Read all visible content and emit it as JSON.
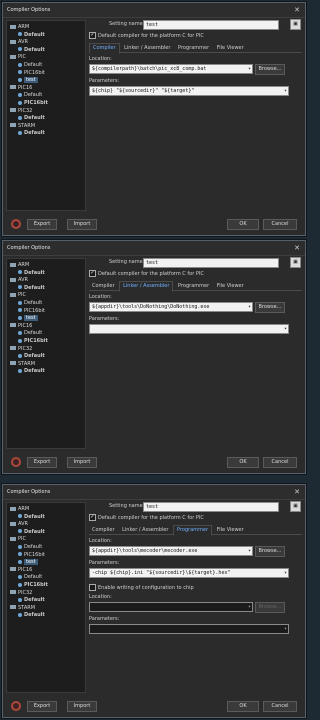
{
  "window_title": "Compiler Options",
  "tree": [
    {
      "label": "ARM",
      "type": "folder"
    },
    {
      "label": "Default",
      "type": "config",
      "bold": true
    },
    {
      "label": "AVR",
      "type": "folder"
    },
    {
      "label": "Default",
      "type": "config",
      "bold": true
    },
    {
      "label": "PIC",
      "type": "folder"
    },
    {
      "label": "Default",
      "type": "config"
    },
    {
      "label": "PIC16bit",
      "type": "config"
    },
    {
      "label": "test",
      "type": "config",
      "selected": true
    },
    {
      "label": "PIC16",
      "type": "folder"
    },
    {
      "label": "Default",
      "type": "config"
    },
    {
      "label": "PIC16bit",
      "type": "config",
      "bold": true
    },
    {
      "label": "PIC32",
      "type": "folder"
    },
    {
      "label": "Default",
      "type": "config",
      "bold": true
    },
    {
      "label": "STARM",
      "type": "folder"
    },
    {
      "label": "Default",
      "type": "config",
      "bold": true
    }
  ],
  "setting_name_label": "Setting name:",
  "setting_name_value": "test",
  "default_checkbox_label": "Default compiler for the platform C for PIC",
  "tabs": [
    "Compiler",
    "Linker / Assembler",
    "Programmer",
    "File Viewer"
  ],
  "location_label": "Location:",
  "parameters_label": "Parameters:",
  "browse_label": "Browse...",
  "export_label": "Export",
  "import_label": "Import",
  "ok_label": "OK",
  "cancel_label": "Cancel",
  "save_icon": "save-icon",
  "dialogs": [
    {
      "active_tab": 0,
      "location": "${compilerpath}\\batch\\pic_xc8_comp.bat",
      "parameters": "${chip} \"${sourcedir}\" \"${target}\""
    },
    {
      "active_tab": 1,
      "location": "${appdir}\\tools\\DoNothing\\DoNothing.exe",
      "parameters": ""
    },
    {
      "active_tab": 2,
      "location": "${appdir}\\tools\\mecoder\\mecoder.exe",
      "parameters": "-chip ${chip}.ini \"${sourcedir}\\${target}.hex\"",
      "enable_config_label": "Enable writing of configuration to chip",
      "location2": "",
      "parameters2": ""
    }
  ]
}
